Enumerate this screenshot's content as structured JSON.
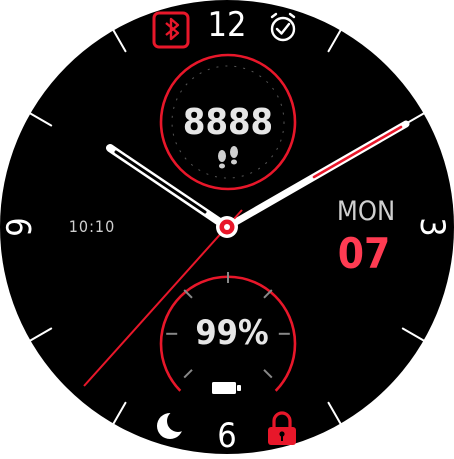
{
  "watch": {
    "hour_markers": {
      "top": "12",
      "bottom": "6",
      "left": "9",
      "right": "3"
    },
    "steps": {
      "value": "8888",
      "icon": "footsteps-icon"
    },
    "battery": {
      "value": "99%",
      "icon": "battery-icon"
    },
    "day": "MON",
    "date": "07",
    "digital_time": "10:10",
    "status_icons": {
      "top_left": "bluetooth-off-icon",
      "top_right": "alarm-icon",
      "bottom_left": "moon-icon",
      "bottom_right": "lock-icon"
    },
    "hands": {
      "hour": "10",
      "minute": "10",
      "second": "37"
    },
    "colors": {
      "background": "#000000",
      "accent": "#e8172a",
      "date_accent": "#ff3b52",
      "text": "#ffffff",
      "muted": "#cfcfcf"
    }
  }
}
